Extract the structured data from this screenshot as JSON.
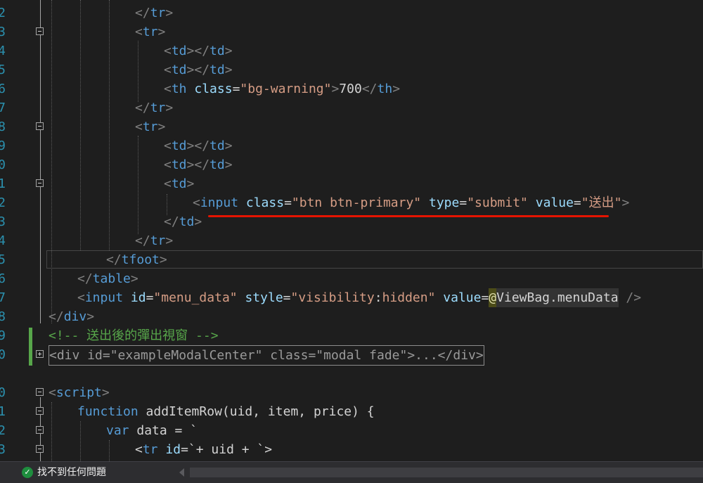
{
  "editor": {
    "lines": [
      {
        "n": "2",
        "tokens": [
          {
            "c": "t",
            "v": "</"
          },
          {
            "c": "tg",
            "v": "tr"
          },
          {
            "c": "t",
            "v": ">"
          }
        ]
      },
      {
        "n": "3",
        "tokens": [
          {
            "c": "t",
            "v": "<"
          },
          {
            "c": "tg",
            "v": "tr"
          },
          {
            "c": "t",
            "v": ">"
          }
        ]
      },
      {
        "n": "4",
        "tokens": [
          {
            "c": "t",
            "v": "<"
          },
          {
            "c": "tg",
            "v": "td"
          },
          {
            "c": "t",
            "v": "></"
          },
          {
            "c": "tg",
            "v": "td"
          },
          {
            "c": "t",
            "v": ">"
          }
        ]
      },
      {
        "n": "5",
        "tokens": [
          {
            "c": "t",
            "v": "<"
          },
          {
            "c": "tg",
            "v": "td"
          },
          {
            "c": "t",
            "v": "></"
          },
          {
            "c": "tg",
            "v": "td"
          },
          {
            "c": "t",
            "v": ">"
          }
        ]
      },
      {
        "n": "6",
        "tokens": [
          {
            "c": "t",
            "v": "<"
          },
          {
            "c": "tg",
            "v": "th"
          },
          {
            "c": "tx",
            "v": " "
          },
          {
            "c": "at",
            "v": "class"
          },
          {
            "c": "tx",
            "v": "="
          },
          {
            "c": "av",
            "v": "\"bg-warning\""
          },
          {
            "c": "t",
            "v": ">"
          },
          {
            "c": "tx",
            "v": "700"
          },
          {
            "c": "t",
            "v": "</"
          },
          {
            "c": "tg",
            "v": "th"
          },
          {
            "c": "t",
            "v": ">"
          }
        ]
      },
      {
        "n": "7",
        "tokens": [
          {
            "c": "t",
            "v": "</"
          },
          {
            "c": "tg",
            "v": "tr"
          },
          {
            "c": "t",
            "v": ">"
          }
        ]
      },
      {
        "n": "8",
        "tokens": [
          {
            "c": "t",
            "v": "<"
          },
          {
            "c": "tg",
            "v": "tr"
          },
          {
            "c": "t",
            "v": ">"
          }
        ]
      },
      {
        "n": "9",
        "tokens": [
          {
            "c": "t",
            "v": "<"
          },
          {
            "c": "tg",
            "v": "td"
          },
          {
            "c": "t",
            "v": "></"
          },
          {
            "c": "tg",
            "v": "td"
          },
          {
            "c": "t",
            "v": ">"
          }
        ]
      },
      {
        "n": "0",
        "tokens": [
          {
            "c": "t",
            "v": "<"
          },
          {
            "c": "tg",
            "v": "td"
          },
          {
            "c": "t",
            "v": "></"
          },
          {
            "c": "tg",
            "v": "td"
          },
          {
            "c": "t",
            "v": ">"
          }
        ]
      },
      {
        "n": "1",
        "tokens": [
          {
            "c": "t",
            "v": "<"
          },
          {
            "c": "tg",
            "v": "td"
          },
          {
            "c": "t",
            "v": ">"
          }
        ]
      },
      {
        "n": "2",
        "tokens": [
          {
            "c": "t",
            "v": "<"
          },
          {
            "c": "tg",
            "v": "input"
          },
          {
            "c": "tx",
            "v": " "
          },
          {
            "c": "at",
            "v": "class"
          },
          {
            "c": "tx",
            "v": "="
          },
          {
            "c": "av",
            "v": "\"btn btn-primary\""
          },
          {
            "c": "tx",
            "v": " "
          },
          {
            "c": "at",
            "v": "type"
          },
          {
            "c": "tx",
            "v": "="
          },
          {
            "c": "av",
            "v": "\"submit\""
          },
          {
            "c": "tx",
            "v": " "
          },
          {
            "c": "at",
            "v": "value"
          },
          {
            "c": "tx",
            "v": "="
          },
          {
            "c": "av",
            "v": "\"送出\""
          },
          {
            "c": "t",
            "v": ">"
          }
        ]
      },
      {
        "n": "3",
        "tokens": [
          {
            "c": "t",
            "v": "</"
          },
          {
            "c": "tg",
            "v": "td"
          },
          {
            "c": "t",
            "v": ">"
          }
        ]
      },
      {
        "n": "4",
        "tokens": [
          {
            "c": "t",
            "v": "</"
          },
          {
            "c": "tg",
            "v": "tr"
          },
          {
            "c": "t",
            "v": ">"
          }
        ]
      },
      {
        "n": "5",
        "tokens": [
          {
            "c": "t",
            "v": "</"
          },
          {
            "c": "tg",
            "v": "tfoot"
          },
          {
            "c": "t",
            "v": ">"
          }
        ]
      },
      {
        "n": "6",
        "tokens": [
          {
            "c": "t",
            "v": "</"
          },
          {
            "c": "tg",
            "v": "table"
          },
          {
            "c": "t",
            "v": ">"
          }
        ]
      },
      {
        "n": "7",
        "tokens": [
          {
            "c": "t",
            "v": "<"
          },
          {
            "c": "tg",
            "v": "input"
          },
          {
            "c": "tx",
            "v": " "
          },
          {
            "c": "at",
            "v": "id"
          },
          {
            "c": "tx",
            "v": "="
          },
          {
            "c": "av",
            "v": "\"menu_data\""
          },
          {
            "c": "tx",
            "v": " "
          },
          {
            "c": "at",
            "v": "style"
          },
          {
            "c": "tx",
            "v": "="
          },
          {
            "c": "av",
            "v": "\"visibility"
          },
          {
            "c": "tx",
            "v": ":"
          },
          {
            "c": "av",
            "v": "hidden\""
          },
          {
            "c": "tx",
            "v": " "
          },
          {
            "c": "at",
            "v": "value"
          },
          {
            "c": "tx",
            "v": "="
          },
          {
            "c": "hl",
            "v": "@"
          },
          {
            "c": "hl2",
            "v": "ViewBag.menuData"
          },
          {
            "c": "tx",
            "v": " "
          },
          {
            "c": "t",
            "v": "/>"
          }
        ]
      },
      {
        "n": "8",
        "tokens": [
          {
            "c": "t",
            "v": "</"
          },
          {
            "c": "tg",
            "v": "div"
          },
          {
            "c": "t",
            "v": ">"
          }
        ]
      },
      {
        "n": "9",
        "tokens": [
          {
            "c": "cm",
            "v": "<!-- 送出後的彈出視窗 -->"
          }
        ]
      },
      {
        "n": "0",
        "tokens": [
          {
            "c": "t",
            "v": "<div id=\"exampleModalCenter\" class=\"modal fade\">...</div>"
          }
        ]
      },
      {
        "n": "",
        "tokens": []
      },
      {
        "n": "0",
        "tokens": [
          {
            "c": "t",
            "v": "<"
          },
          {
            "c": "tg",
            "v": "script"
          },
          {
            "c": "t",
            "v": ">"
          }
        ]
      },
      {
        "n": "1",
        "tokens": [
          {
            "c": "kw",
            "v": "function"
          },
          {
            "c": "tx",
            "v": " addItemRow(uid, item, price) {"
          }
        ]
      },
      {
        "n": "2",
        "tokens": [
          {
            "c": "kw",
            "v": "var"
          },
          {
            "c": "tx",
            "v": " data = `"
          }
        ]
      },
      {
        "n": "3",
        "tokens": [
          {
            "c": "tx",
            "v": "<"
          },
          {
            "c": "tg",
            "v": "tr"
          },
          {
            "c": "tx",
            "v": " "
          },
          {
            "c": "at",
            "v": "id"
          },
          {
            "c": "tx",
            "v": "=`+ uid + `>"
          }
        ]
      }
    ]
  },
  "status": {
    "icon": "check-circle-icon",
    "text": "找不到任何問題"
  }
}
